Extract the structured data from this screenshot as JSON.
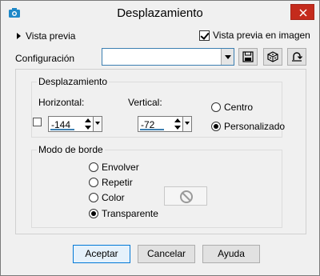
{
  "window": {
    "title": "Desplazamiento"
  },
  "preview": {
    "label": "Vista previa"
  },
  "preview_on_image": {
    "label": "Vista previa en imagen",
    "checked": true
  },
  "config": {
    "label": "Configuración",
    "value": ""
  },
  "displacement": {
    "title": "Desplazamiento",
    "horizontal_label": "Horizontal:",
    "horizontal_value": "-144",
    "vertical_label": "Vertical:",
    "vertical_value": "-72",
    "options": [
      {
        "label": "Centro",
        "selected": false
      },
      {
        "label": "Personalizado",
        "selected": true
      }
    ]
  },
  "border_mode": {
    "title": "Modo de borde",
    "options": [
      {
        "label": "Envolver",
        "selected": false
      },
      {
        "label": "Repetir",
        "selected": false
      },
      {
        "label": "Color",
        "selected": false
      },
      {
        "label": "Transparente",
        "selected": true
      }
    ]
  },
  "buttons": {
    "ok": "Aceptar",
    "cancel": "Cancelar",
    "help": "Ayuda"
  },
  "colors": {
    "accent": "#0078d7",
    "close": "#c42b1c",
    "underline": "#3c7fb1"
  }
}
